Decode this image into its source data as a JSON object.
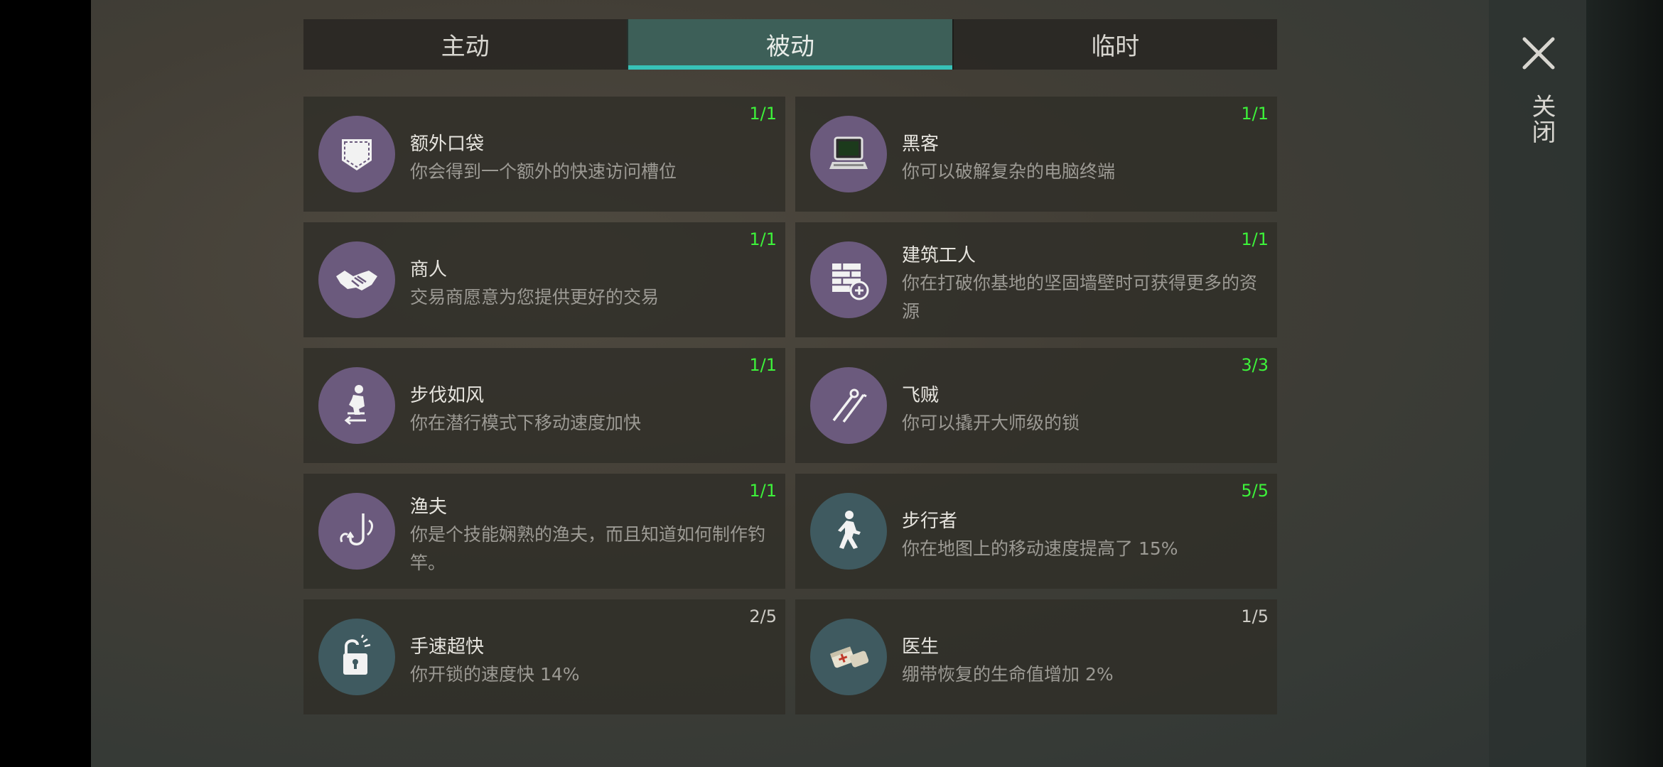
{
  "tabs": [
    {
      "label": "主动",
      "active": false
    },
    {
      "label": "被动",
      "active": true
    },
    {
      "label": "临时",
      "active": false
    }
  ],
  "close": {
    "label": "关闭",
    "icon": "close-icon"
  },
  "colors": {
    "accent": "#37c2b8",
    "count_complete": "#3df23a",
    "count_incomplete": "#cfcdc7",
    "icon_purple": "#6b5a7d",
    "icon_teal": "#3f5a60"
  },
  "skills": [
    {
      "title": "额外口袋",
      "desc": "你会得到一个额外的快速访问槽位",
      "count": "1/1",
      "icon": "pocket-icon"
    },
    {
      "title": "黑客",
      "desc": "你可以破解复杂的电脑终端",
      "count": "1/1",
      "icon": "computer-terminal-icon"
    },
    {
      "title": "商人",
      "desc": "交易商愿意为您提供更好的交易",
      "count": "1/1",
      "icon": "handshake-icon"
    },
    {
      "title": "建筑工人",
      "desc": "你在打破你基地的坚固墙壁时可获得更多的资源",
      "count": "1/1",
      "icon": "brick-wall-plus-icon"
    },
    {
      "title": "步伐如风",
      "desc": "你在潜行模式下移动速度加快",
      "count": "1/1",
      "icon": "sneak-icon"
    },
    {
      "title": "飞贼",
      "desc": "你可以撬开大师级的锁",
      "count": "3/3",
      "icon": "lockpick-icon"
    },
    {
      "title": "渔夫",
      "desc": "你是个技能娴熟的渔夫，而且知道如何制作钓竿。",
      "count": "1/1",
      "icon": "fishhook-icon"
    },
    {
      "title": "步行者",
      "desc": "你在地图上的移动速度提高了 15%",
      "count": "5/5",
      "icon": "walker-icon"
    },
    {
      "title": "手速超快",
      "desc": "你开锁的速度快 14%",
      "count": "2/5",
      "icon": "unlock-icon"
    },
    {
      "title": "医生",
      "desc": "绷带恢复的生命值增加 2%",
      "count": "1/5",
      "icon": "bandage-icon"
    }
  ]
}
